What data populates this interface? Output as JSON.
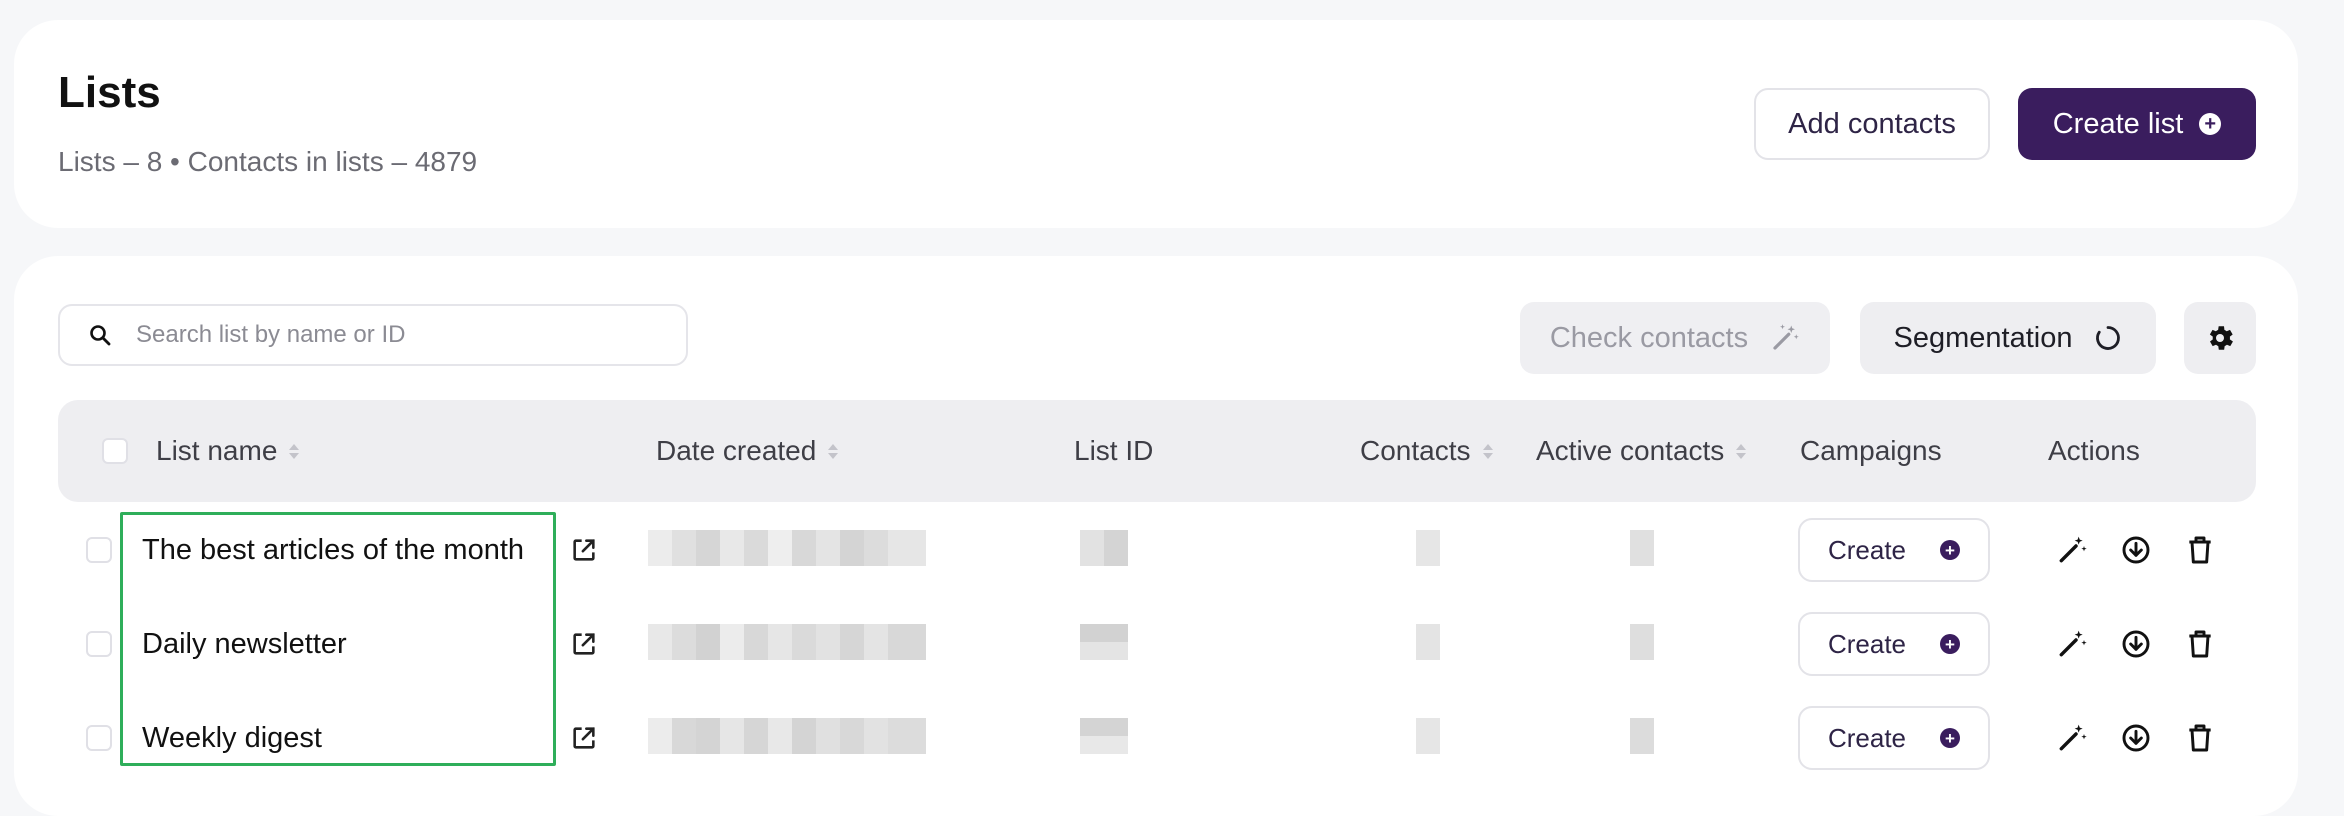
{
  "header": {
    "title": "Lists",
    "subtitle": "Lists – 8 • Contacts in lists – 4879",
    "add_contacts_label": "Add contacts",
    "create_list_label": "Create list"
  },
  "toolbar": {
    "search_placeholder": "Search list by name or ID",
    "check_contacts_label": "Check contacts",
    "segmentation_label": "Segmentation"
  },
  "table": {
    "columns": {
      "list_name": "List name",
      "date_created": "Date created",
      "list_id": "List ID",
      "contacts": "Contacts",
      "active_contacts": "Active contacts",
      "campaigns": "Campaigns",
      "actions": "Actions"
    },
    "rows": [
      {
        "name": "The best articles of the month",
        "campaign_button": "Create"
      },
      {
        "name": "Daily newsletter",
        "campaign_button": "Create"
      },
      {
        "name": "Weekly digest",
        "campaign_button": "Create"
      }
    ]
  },
  "colors": {
    "brand": "#3a1d5e",
    "highlight": "#2fae5a"
  },
  "icons": {
    "search": "search-icon",
    "magic_wand": "magic-wand-icon",
    "refresh": "refresh-icon",
    "settings": "gear-icon",
    "external_link": "external-link-icon",
    "download": "download-icon",
    "delete": "trash-icon"
  }
}
